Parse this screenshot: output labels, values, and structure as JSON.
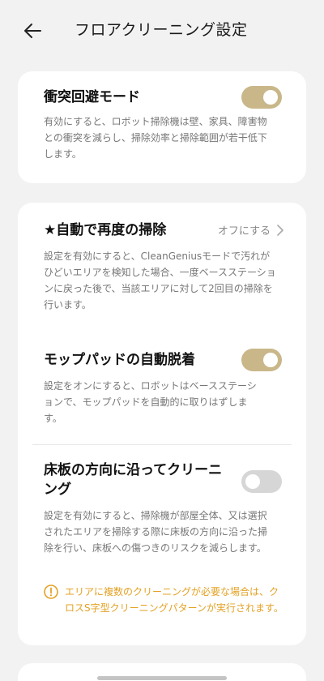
{
  "header": {
    "title": "フロアクリーニング設定"
  },
  "card1": {
    "title": "衝突回避モード",
    "description": "有効にすると、ロボット掃除機は壁、家具、障害物との衝突を減らし、掃除効率と掃除範囲が若干低下します。",
    "toggle_on": true
  },
  "card2": {
    "rows": [
      {
        "title": "★自動で再度の掃除",
        "value": "オフにする",
        "description": "設定を有効にすると、CleanGeniusモードで汚れがひどいエリアを検知した場合、一度ベースステーションに戻った後で、当該エリアに対して2回目の掃除を行います。"
      },
      {
        "title": "モップパッドの自動脱着",
        "description": "設定をオンにすると、ロボットはベースステーションで、モップパッドを自動的に取りはずします。",
        "toggle_on": true
      },
      {
        "title": "床板の方向に沿ってクリーニング",
        "description": "設定を有効にすると、掃除機が部屋全体、又は選択されたエリアを掃除する際に床板の方向に沿った掃除を行い、床板への傷つきのリスクを減らします。",
        "toggle_on": false,
        "warning": "エリアに複数のクリーニングが必要な場合は、クロスS字型クリーニングパターンが実行されます。"
      }
    ]
  },
  "colors": {
    "accent": "#c9b78a",
    "warning": "#e3a123",
    "background": "#f2f2f2"
  }
}
